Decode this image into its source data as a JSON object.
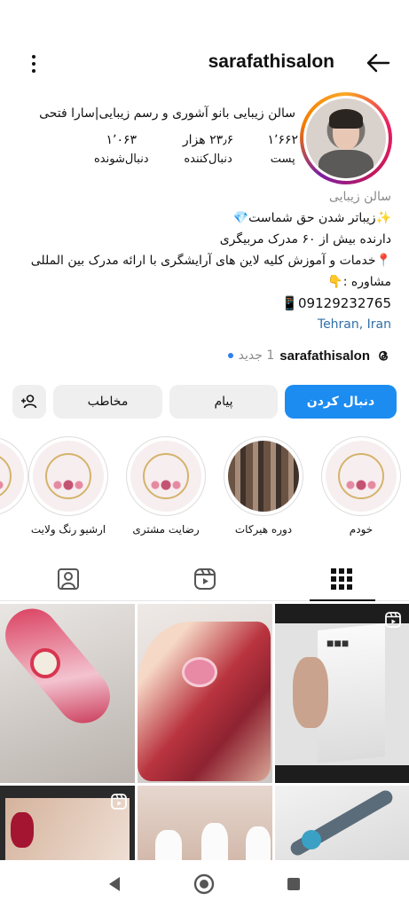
{
  "header": {
    "username": "sarafathisalon"
  },
  "profile": {
    "title": "سالن زیبایی بانو آشوری و رسم زیبایی|سارا فتحی",
    "stats": [
      {
        "value": "۱٬۶۶۲",
        "label": "پست"
      },
      {
        "value": "۲۳٫۶ هزار",
        "label": "دنبال‌کننده"
      },
      {
        "value": "۱٬۰۶۳",
        "label": "دنبال‌شونده"
      }
    ]
  },
  "bio": {
    "category": "سالن زیبایی",
    "lines": [
      "✨زیباتر شدن حق شماست💎",
      "دارنده  بیش از ۶۰ مدرک مربیگری",
      "📍خدمات و آموزش کلیه لاین های آرایشگری با ارائه مدرک بین المللی",
      "مشاوره :👇",
      "09129232765📱"
    ],
    "location": "Tehran, Iran"
  },
  "threads": {
    "name": "sarafathisalon",
    "new_label": "1 جدید"
  },
  "buttons": {
    "follow": "دنبال کردن",
    "message": "پیام",
    "contact": "مخاطب"
  },
  "highlights": [
    {
      "label": "خودم"
    },
    {
      "label": "دوره هیرکات"
    },
    {
      "label": "رضایت مشتری"
    },
    {
      "label": "ارشیو رنگ ولایت"
    }
  ],
  "icons": {
    "menu": "more-vertical-icon",
    "back": "arrow-left-icon",
    "threads": "threads-icon",
    "add_user": "add-user-icon",
    "grid": "grid-icon",
    "reels": "reels-icon",
    "tagged": "tagged-icon"
  },
  "colors": {
    "accent": "#1c8cf0",
    "link": "#2f6fa8",
    "muted": "#8a8a8a"
  }
}
